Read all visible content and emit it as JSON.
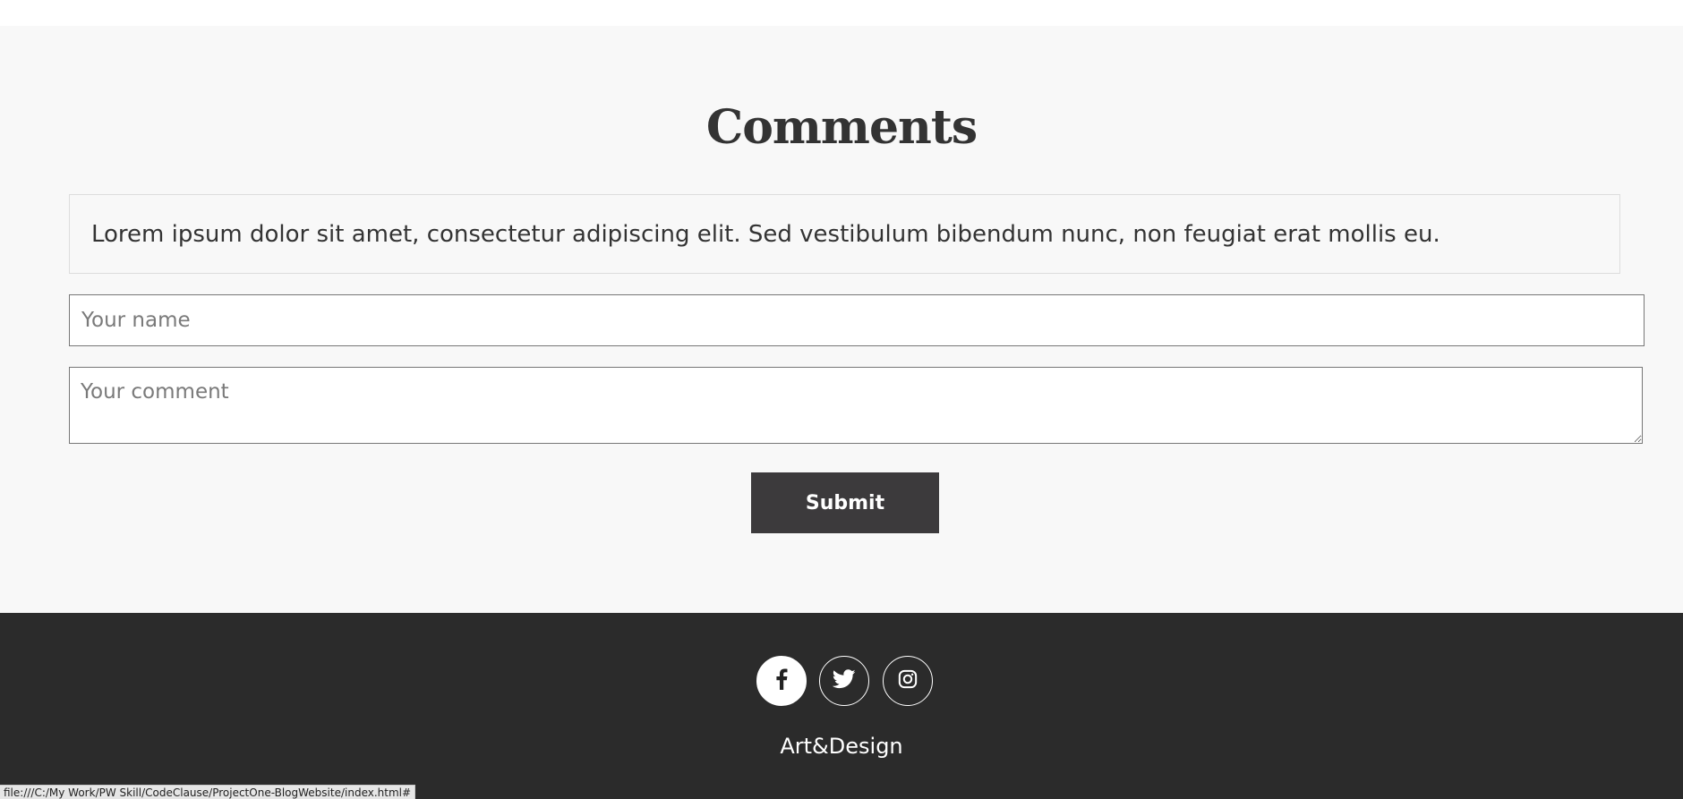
{
  "comments": {
    "title": "Comments",
    "existing_comment": "Lorem ipsum dolor sit amet, consectetur adipiscing elit. Sed vestibulum bibendum nunc, non feugiat erat mollis eu.",
    "name_placeholder": "Your name",
    "comment_placeholder": "Your comment",
    "submit_label": "Submit"
  },
  "footer": {
    "social": [
      {
        "icon": "facebook-icon"
      },
      {
        "icon": "twitter-icon"
      },
      {
        "icon": "instagram-icon"
      }
    ],
    "brand": "Art&Design"
  },
  "status_bar": {
    "url": "file:///C:/My Work/PW Skill/CodeClause/ProjectOne-BlogWebsite/index.html#"
  },
  "colors": {
    "section_bg": "#f8f8f8",
    "footer_bg": "#2b2b2b",
    "button_bg": "#3c3a3c",
    "text_dark": "#333333"
  }
}
